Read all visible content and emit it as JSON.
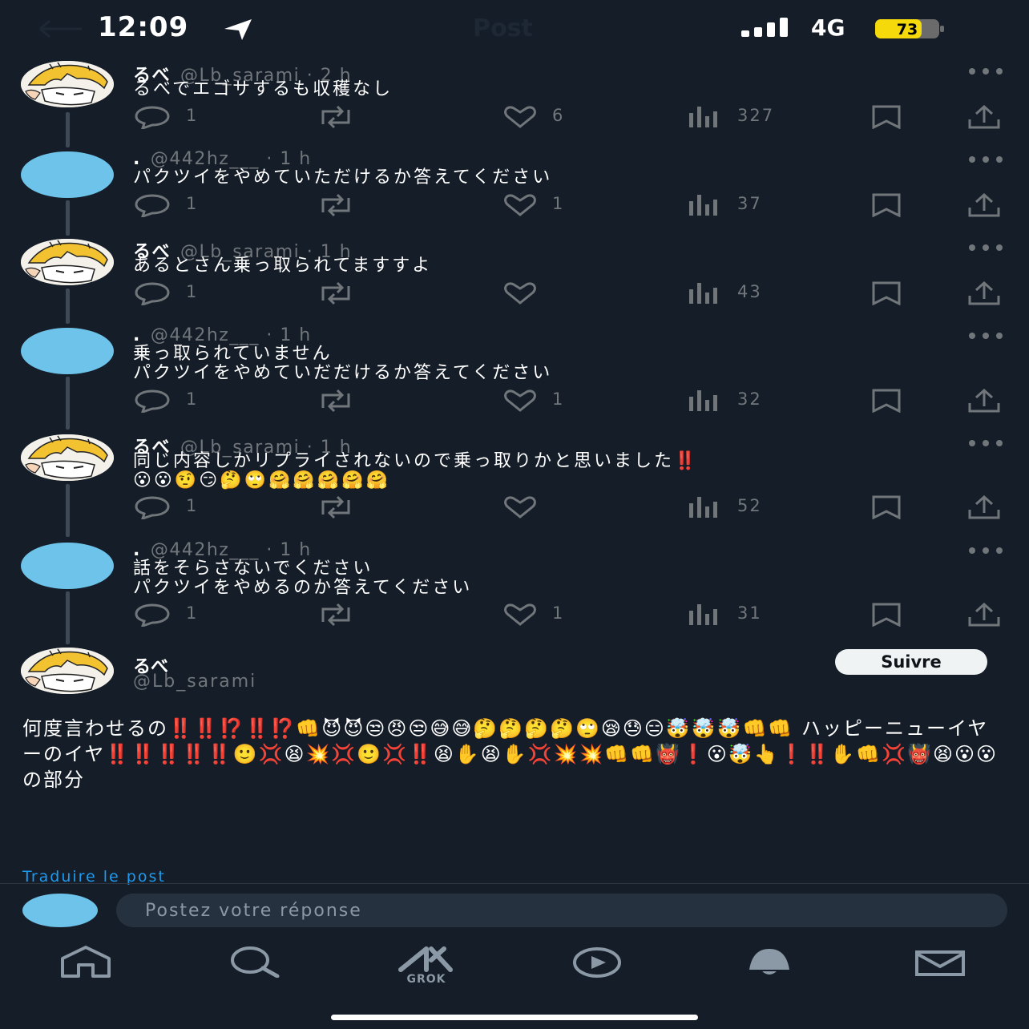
{
  "status": {
    "time": "12:09",
    "network": "4G",
    "battery": "73"
  },
  "header": {
    "title": "Post"
  },
  "tweets": [
    {
      "name": "るべ",
      "meta": "@Lb_sarami · 2 h",
      "text": "るべでエゴサするも収穫なし",
      "replies": "1",
      "likes": "6",
      "views": "327"
    },
    {
      "name": ".",
      "meta": "@442hz___ · 1 h",
      "text": "パクツイをやめていただけるか答えてください",
      "replies": "1",
      "likes": "1",
      "views": "37"
    },
    {
      "name": "るべ",
      "meta": "@Lb_sarami · 1 h",
      "text": "あるとさん乗っ取られてますすよ",
      "replies": "1",
      "likes": "",
      "views": "43"
    },
    {
      "name": ".",
      "meta": "@442hz___ · 1 h",
      "text": "乗っ取られていません\nパクツイをやめていだだけるか答えてください",
      "replies": "1",
      "likes": "1",
      "views": "32"
    },
    {
      "name": "るべ",
      "meta": "@Lb_sarami · 1 h",
      "text": "同じ内容しかリプライされないので乗っ取りかと思いました‼️\n😮😮🤨😏🤔🙄🤗🤗🤗🤗🤗",
      "replies": "1",
      "likes": "",
      "views": "52"
    },
    {
      "name": ".",
      "meta": "@442hz___ · 1 h",
      "text": "話をそらさないでください\nパクツイをやめるのか答えてください",
      "replies": "1",
      "likes": "1",
      "views": "31"
    }
  ],
  "main_post": {
    "name": "るべ",
    "handle": "@Lb_sarami",
    "follow_label": "Suivre",
    "text": "何度言わせるの‼️‼️⁉️‼️⁉️👊😈😈😒😠😒😅😅🤔🤔🤔🤔🙄😪😓😑🤯🤯🤯👊👊\nハッピーニューイヤーのイヤ‼️‼️‼️‼️‼️🙂💢😫💥💢🙂💢‼️😫✋😫✋💢💥💥👊👊👹❗😮🤯👆❗‼️✋👊💢👹😫😮😮の部分",
    "translate": "Traduire le post"
  },
  "reply": {
    "placeholder": "Postez votre réponse"
  },
  "nav": {
    "grok_label": "GROK"
  },
  "colors": {
    "background": "#151d28",
    "accent": "#1d9bf0",
    "avatar_blue": "#6ec3ea",
    "battery": "#f5d90a"
  }
}
